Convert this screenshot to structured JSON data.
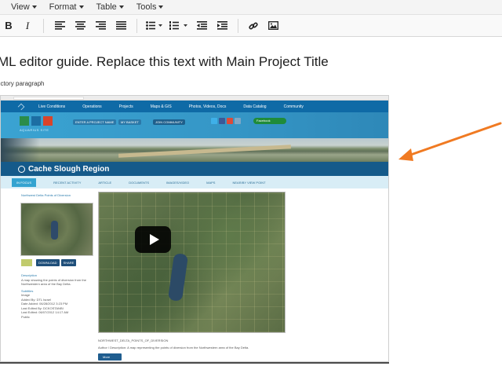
{
  "menu": [
    {
      "label": "View"
    },
    {
      "label": "Format"
    },
    {
      "label": "Table"
    },
    {
      "label": "Tools"
    }
  ],
  "toolbar": {
    "bold_label": "B",
    "italic_label": "I"
  },
  "document": {
    "title": "ML editor guide. Replace this text with Main Project Title",
    "intro": "uctory paragraph"
  },
  "screenshot": {
    "nav": [
      "Live Conditions",
      "Operations",
      "Projects",
      "Maps & GIS",
      "Photos, Videos, Docs",
      "Data Catalog",
      "Community"
    ],
    "header_buttons": [
      "ENTER A PROJECT NAME",
      "MY BASKET",
      "JOIN COMMUNITY"
    ],
    "logo_text": "AQUARIUS SITE",
    "search_label": "Facebook",
    "region_title": "Cache Slough Region",
    "tabs": [
      "IN FOCUS",
      "RECENT ACTIVITY",
      "ARTICLE",
      "DOCUMENTS",
      "IMAGES/VIDEO",
      "MAPS",
      "NEAR/BY VIEW POINT"
    ],
    "sidebar_title": "Northwest Delta Points of Diversion",
    "download_label": "DOWNLOAD",
    "share_label": "SHARE",
    "meta": {
      "description_label": "Description",
      "description": "A map showing the points of diversion from the Northwestern area of the Bay Delta.",
      "subtitle_label": "Subtitles",
      "type": "Image",
      "added_by": "Added By: DTL Israel",
      "date_added": "Date Added: 06/28/2012 3:23 PM",
      "last_edited_by": "Last Edited By: DCKOSTANBI",
      "last_edited": "Last Edited: 06/07/2012 14:17 AM",
      "public": "Public"
    },
    "caption": "NORTHWEST_DELTA_POINTS_OF_DIVERSION",
    "caption2": "Author / Description: A map representing the points of diversion from the Northwestern area of the Bay Delta.",
    "more_label": "More"
  },
  "colors": {
    "accent_arrow": "#f07a22",
    "nav_blue": "#0f6aa6",
    "header_blue": "#3aa3d2"
  }
}
